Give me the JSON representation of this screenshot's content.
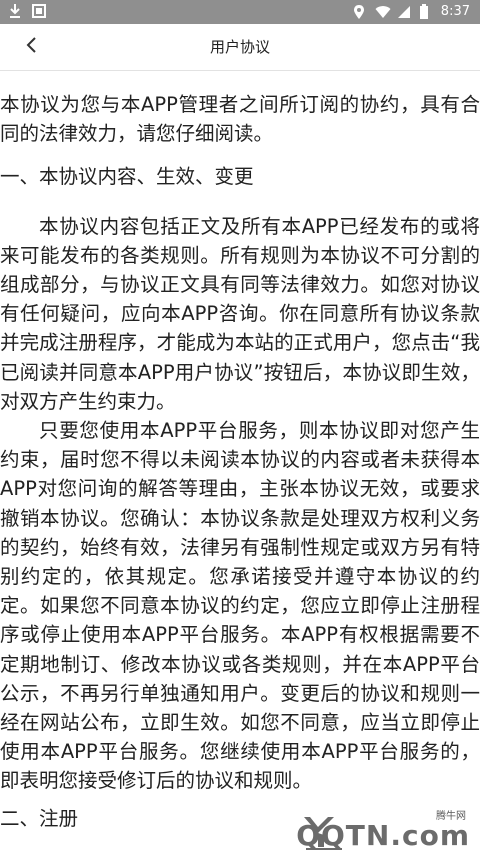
{
  "status_bar": {
    "time": "8:37",
    "left_icons": [
      "download-icon",
      "image-icon"
    ],
    "right_icons": [
      "location-icon",
      "wifi-icon",
      "signal-icon",
      "battery-icon"
    ]
  },
  "header": {
    "title": "用户协议",
    "back_icon": "chevron-left-icon"
  },
  "content": {
    "intro": "本协议为您与本APP管理者之间所订阅的协约，具有合同的法律效力，请您仔细阅读。",
    "section1_heading": "一、本协议内容、生效、变更",
    "section1_para1": "本协议内容包括正文及所有本APP已经发布的或将来可能发布的各类规则。所有规则为本协议不可分割的组成部分，与协议正文具有同等法律效力。如您对协议有任何疑问，应向本APP咨询。你在同意所有协议条款并完成注册程序，才能成为本站的正式用户，您点击“我已阅读并同意本APP用户协议”按钮后，本协议即生效，对双方产生约束力。",
    "section1_para2": "只要您使用本APP平台服务，则本协议即对您产生约束，届时您不得以未阅读本协议的内容或者未获得本APP对您问询的解答等理由，主张本协议无效，或要求撤销本协议。您确认：本协议条款是处理双方权利义务的契约，始终有效，法律另有强制性规定或双方另有特别约定的，依其规定。您承诺接受并遵守本协议的约定。如果您不同意本协议的约定，您应立即停止注册程序或停止使用本APP平台服务。本APP有权根据需要不定期地制订、修改本协议或各类规则，并在本APP平台公示，不再另行单独通知用户。变更后的协议和规则一经在网站公布，立即生效。如您不同意，应当立即停止使用本APP平台服务。您继续使用本APP平台服务的，即表明您接受修订后的协议和规则。",
    "section2_heading": "二、注册"
  },
  "watermark": {
    "small_text": "腾牛网",
    "brand_text": "QQTN.com"
  }
}
